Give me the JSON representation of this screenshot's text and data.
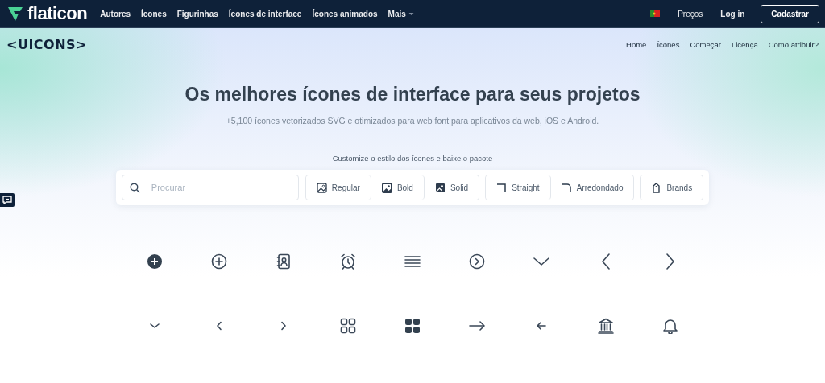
{
  "topnav": {
    "brand": "flaticon",
    "links": [
      "Autores",
      "Ícones",
      "Figurinhas",
      "Ícones de interface",
      "Ícones animados"
    ],
    "more": "Mais",
    "right_links": [
      "Preços",
      "Log in"
    ],
    "signup": "Cadastrar"
  },
  "subnav": {
    "logo": "<UICONS>",
    "links": [
      "Home",
      "Ícones",
      "Começar",
      "Licença",
      "Como atribuir?"
    ]
  },
  "hero": {
    "title": "Os melhores ícones de interface para seus projetos",
    "subtitle": "+5,100 ícones vetorizados SVG e otimizados para web font para aplicativos da web, iOS e Android."
  },
  "customize": {
    "label": "Customize o estilo dos ícones e baixe o pacote",
    "search": {
      "placeholder": "Procurar"
    },
    "groups": [
      [
        {
          "label": "Regular",
          "kind": "regular"
        },
        {
          "label": "Bold",
          "kind": "bold"
        },
        {
          "label": "Solid",
          "kind": "solid"
        }
      ],
      [
        {
          "label": "Straight",
          "kind": "straight"
        },
        {
          "label": "Arredondado",
          "kind": "rounded"
        }
      ],
      [
        {
          "label": "Brands",
          "kind": "brands"
        }
      ]
    ]
  }
}
